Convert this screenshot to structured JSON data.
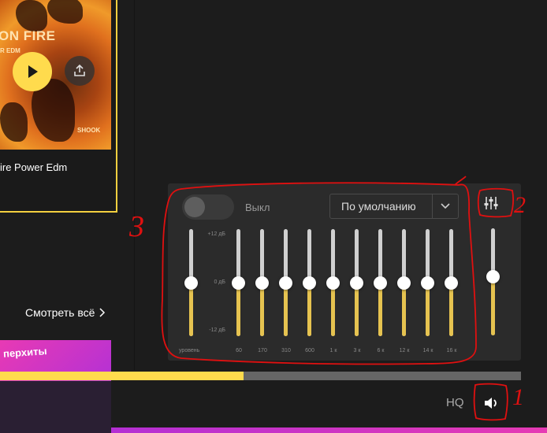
{
  "album": {
    "cover_title": "ON FIRE",
    "cover_subtitle": "R EDM",
    "cover_brand": "SHOOK",
    "name": "ire Power Edm"
  },
  "see_all": {
    "label": "Смотреть всё",
    "icon": "chevron-right-icon"
  },
  "promo": {
    "label": "перхиты"
  },
  "equalizer": {
    "toggle_label": "Выкл",
    "toggle_on": false,
    "preset": {
      "selected": "По умолчанию",
      "icon": "chevron-down-icon"
    },
    "db_scale": {
      "top": "+12 дБ",
      "mid": "0 дБ",
      "bottom": "-12 дБ"
    },
    "level_label": "уровень",
    "preamp_db": 0,
    "bands": [
      {
        "freq": "60",
        "gain_db": 0
      },
      {
        "freq": "170",
        "gain_db": 0
      },
      {
        "freq": "310",
        "gain_db": 0
      },
      {
        "freq": "600",
        "gain_db": 0
      },
      {
        "freq": "1 к",
        "gain_db": 0
      },
      {
        "freq": "3 к",
        "gain_db": 0
      },
      {
        "freq": "6 к",
        "gain_db": 0
      },
      {
        "freq": "12 к",
        "gain_db": 0
      },
      {
        "freq": "14 к",
        "gain_db": 0
      },
      {
        "freq": "16 к",
        "gain_db": 0
      }
    ]
  },
  "volume": {
    "level": 0.55,
    "icon": "speaker-icon"
  },
  "player": {
    "progress": 0.467,
    "quality_label": "HQ",
    "equalizer_icon": "equalizer-icon"
  },
  "annotations": {
    "one": "1",
    "two": "2",
    "three": "3"
  },
  "colors": {
    "accent": "#ffdb4d",
    "annotation": "#e01010",
    "panel": "#2b2b2b"
  }
}
